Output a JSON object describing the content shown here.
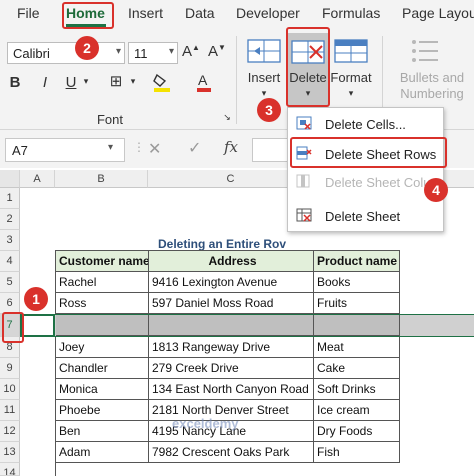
{
  "menu": {
    "tabs": [
      "File",
      "Home",
      "Insert",
      "Data",
      "Developer",
      "Formulas",
      "Page Layou"
    ]
  },
  "ribbon": {
    "font_name": "Calibri",
    "font_size": "11",
    "font_group_label": "Font",
    "insert_label": "Insert",
    "delete_label": "Delete",
    "format_label": "Format",
    "bullets_label_1": "Bullets and",
    "bullets_label_2": "Numbering"
  },
  "formula_bar": {
    "name_box": "A7",
    "fx": "fx"
  },
  "delete_menu": {
    "items": [
      "Delete Cells...",
      "Delete Sheet Rows",
      "Delete Sheet Colu",
      "Delete Sheet"
    ]
  },
  "sheet": {
    "columns": [
      "A",
      "B",
      "C"
    ],
    "rows": [
      "1",
      "2",
      "3",
      "4",
      "5",
      "6",
      "7",
      "8",
      "9",
      "10",
      "11",
      "12",
      "13",
      "14"
    ],
    "title": "Deleting an Entire Rov",
    "headers": [
      "Customer name",
      "Address",
      "Product name"
    ],
    "data": [
      [
        "Rachel",
        "9416 Lexington Avenue",
        "Books"
      ],
      [
        "Ross",
        "597 Daniel Moss Road",
        "Fruits"
      ],
      [
        "",
        "",
        ""
      ],
      [
        "Joey",
        "1813 Rangeway Drive",
        "Meat"
      ],
      [
        "Chandler",
        "279 Creek Drive",
        "Cake"
      ],
      [
        "Monica",
        "134 East North Canyon Road",
        "Soft Drinks"
      ],
      [
        "Phoebe",
        "2181 North Denver Street",
        "Ice cream"
      ],
      [
        "Ben",
        "4195 Nancy Lane",
        "Dry Foods"
      ],
      [
        "Adam",
        "7982 Crescent Oaks Park",
        "Fish"
      ]
    ]
  },
  "callouts": [
    "1",
    "2",
    "3",
    "4"
  ],
  "colors": {
    "accent_green": "#1e7145",
    "callout_red": "#d9312b",
    "header_fill": "#e2efda",
    "selected_row": "#d0d0d0"
  },
  "watermark": "exceldemy"
}
